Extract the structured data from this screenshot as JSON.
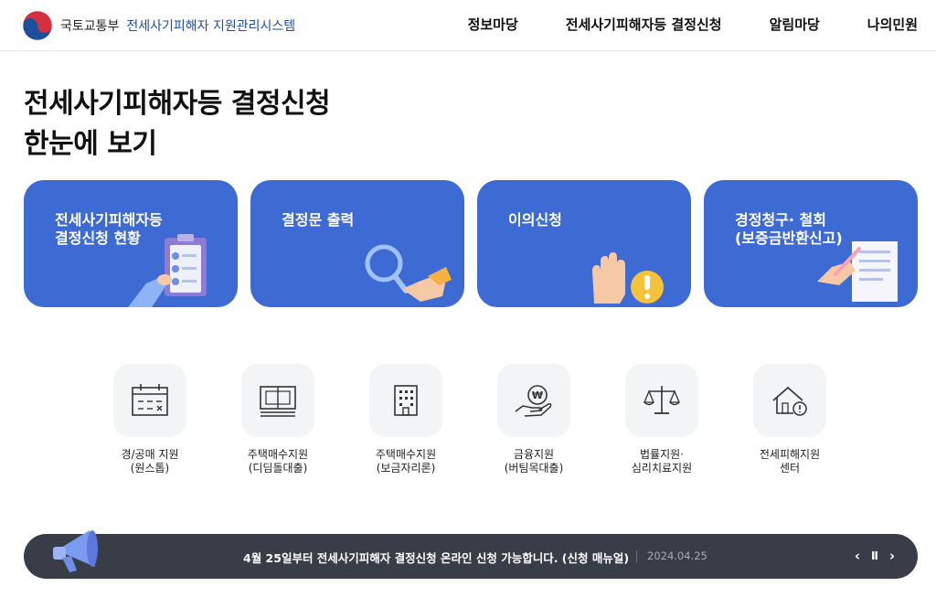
{
  "header": {
    "ministry": "국토교통부",
    "system_name": "전세사기피해자 지원관리시스템",
    "nav": [
      "정보마당",
      "전세사기피해자등 결정신청",
      "알림마당",
      "나의민원"
    ]
  },
  "page_title": "전세사기피해자등 결정신청\n한눈에 보기",
  "cards": [
    {
      "label": "전세사기피해자등\n결정신청 현황",
      "icon": "clipboard-checklist-icon"
    },
    {
      "label": "결정문 출력",
      "icon": "magnifier-icon"
    },
    {
      "label": "이의신청",
      "icon": "raised-hand-warning-icon"
    },
    {
      "label": "경정청구· 철회\n(보증금반환신고)",
      "icon": "document-pen-icon"
    }
  ],
  "quick_links": [
    {
      "label": "경/공매 지원\n(원스톱)",
      "icon": "calendar-icon"
    },
    {
      "label": "주택매수지원\n(디딤돌대출)",
      "icon": "money-bundle-icon"
    },
    {
      "label": "주택매수지원\n(보금자리론)",
      "icon": "building-icon"
    },
    {
      "label": "금융지원\n(버팀목대출)",
      "icon": "won-coin-hand-icon"
    },
    {
      "label": "법률지원·\n심리치료지원",
      "icon": "scales-icon"
    },
    {
      "label": "전세피해지원\n센터",
      "icon": "house-alert-icon"
    }
  ],
  "notice": {
    "text": "4월 25일부터 전세사기피해자 결정신청 온라인 신청 가능합니다. (신청 매뉴얼)",
    "date": "2024.04.25",
    "prev": "‹",
    "pause": "Ⅱ",
    "next": "›"
  },
  "colors": {
    "card_blue": "#3e6bd3",
    "notice_bg": "#393d47",
    "brand_blue": "#1f4e9c"
  }
}
